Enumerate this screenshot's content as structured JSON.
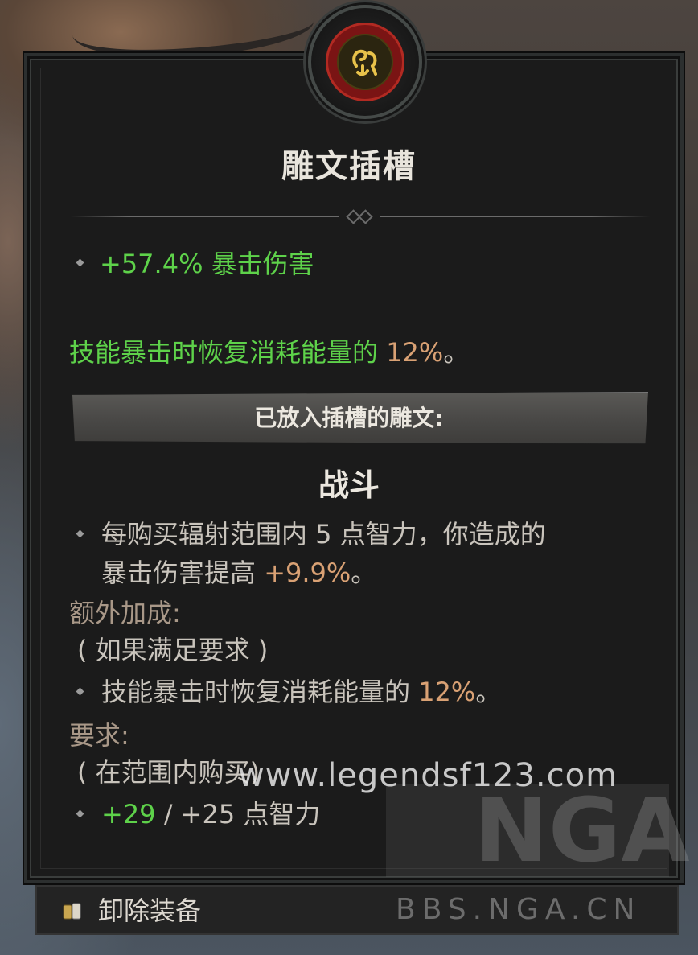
{
  "title": "雕文插槽",
  "stat": {
    "value": "+57.4%",
    "text": " 暴击伤害"
  },
  "effect": {
    "text": "技能暴击时恢复消耗能量的 ",
    "value": "12%",
    "suffix": "。"
  },
  "banner": "已放入插槽的雕文:",
  "rune": {
    "name": "战斗",
    "desc_line1": "每购买辐射范围内 5 点智力，你造成的",
    "desc_line2_text": "暴击伤害提高 ",
    "desc_line2_value": "+9.9%",
    "desc_line2_suffix": "。",
    "bonus_label": "额外加成:",
    "bonus_condition": "( 如果满足要求 )",
    "bonus_text": "技能暴击时恢复消耗能量的 ",
    "bonus_value": "12%",
    "bonus_suffix": "。",
    "req_label": "要求:",
    "req_condition": "( 在范围内购买)",
    "req_current": "+29",
    "req_separator": " / ",
    "req_text": "+25 点智力"
  },
  "footer": {
    "action": "卸除装备"
  },
  "watermark": {
    "url": "www.legendsf123.com",
    "brand": "NGA",
    "site": "BBS.NGA.CN"
  },
  "colors": {
    "positive": "#5ed24a",
    "value": "#d9a174",
    "label": "#a99888"
  }
}
